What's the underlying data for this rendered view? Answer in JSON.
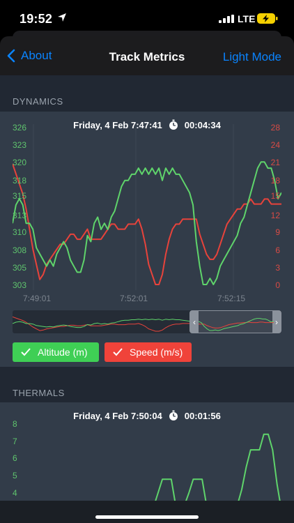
{
  "status_bar": {
    "time": "19:52",
    "network": "LTE"
  },
  "nav": {
    "back_label": "About",
    "title": "Track Metrics",
    "right_label": "Light Mode"
  },
  "dynamics": {
    "section_label": "DYNAMICS",
    "datetime": "Friday, 4 Feb 7:47:41",
    "duration": "00:04:34",
    "legend": {
      "altitude": "Altitude (m)",
      "speed": "Speed (m/s)"
    }
  },
  "thermals": {
    "section_label": "THERMALS",
    "datetime": "Friday, 4 Feb 7:50:04",
    "duration": "00:01:56"
  },
  "colors": {
    "altitude": "#5fd46b",
    "speed": "#e8433b",
    "accent": "#0a84ff"
  },
  "icons": {
    "back": "chevron-left-icon",
    "timer": "stopwatch-icon",
    "check": "checkmark-icon"
  },
  "chart_data": [
    {
      "type": "line",
      "title": "",
      "x_ticks": [
        "7:49:01",
        "7:52:01",
        "7:52:15"
      ],
      "y_left_ticks": [
        "326",
        "323",
        "320",
        "318",
        "315",
        "313",
        "310",
        "308",
        "305",
        "303"
      ],
      "y_right_ticks": [
        "28",
        "24",
        "21",
        "18",
        "15",
        "12",
        "9",
        "6",
        "3",
        "0"
      ],
      "ylim_left": [
        303,
        326
      ],
      "ylim_right": [
        0,
        28
      ],
      "series": [
        {
          "name": "Altitude (m)",
          "axis": "left",
          "values": [
            313,
            316,
            317,
            316,
            313,
            313,
            312,
            309,
            308,
            307,
            306,
            307,
            306,
            308,
            309,
            310,
            309,
            307,
            306,
            305,
            305,
            307,
            311,
            310,
            313,
            314,
            312,
            313,
            312,
            314,
            315,
            317,
            319,
            320,
            320,
            321,
            321,
            322,
            321,
            322,
            321,
            322,
            321,
            322,
            320,
            322,
            321,
            322,
            321,
            321,
            320,
            319,
            318,
            316,
            310,
            306,
            303,
            303,
            304,
            303,
            304,
            306,
            307,
            308,
            309,
            310,
            311,
            313,
            314,
            316,
            318,
            320,
            322,
            323,
            323,
            322,
            322,
            320,
            317,
            318
          ]
        },
        {
          "name": "Speed (m/s)",
          "axis": "right",
          "values": [
            24,
            22,
            20,
            18,
            15,
            11,
            7,
            4,
            1,
            2,
            4,
            5,
            6,
            7,
            8,
            8,
            9,
            10,
            10,
            9,
            9,
            10,
            11,
            9,
            9,
            9,
            9,
            10,
            11,
            12,
            12,
            11,
            11,
            11,
            12,
            12,
            12,
            13,
            11,
            8,
            4,
            2,
            0,
            0,
            2,
            6,
            9,
            11,
            12,
            12,
            13,
            13,
            13,
            13,
            13,
            10,
            8,
            6,
            5,
            5,
            6,
            8,
            10,
            12,
            13,
            14,
            15,
            15,
            16,
            16,
            17,
            16,
            16,
            16,
            17,
            17,
            16,
            16,
            16,
            16
          ]
        }
      ]
    },
    {
      "type": "line",
      "title": "",
      "y_ticks": [
        "8",
        "7",
        "6",
        "5",
        "4"
      ],
      "ylim": [
        3.2,
        8.2
      ],
      "series": [
        {
          "name": "",
          "values": [
            3,
            3,
            3,
            3,
            3,
            3,
            3,
            3,
            3,
            3,
            3,
            3,
            3,
            3,
            3,
            3,
            3,
            3,
            3,
            3,
            3,
            3,
            3,
            3,
            3,
            3,
            3,
            3,
            3,
            3,
            3,
            3,
            3.2,
            4,
            4.8,
            4.8,
            4.8,
            3.3,
            3.3,
            3.3,
            4,
            4.8,
            4.8,
            4.8,
            3.3,
            3.3,
            3.3,
            3.3,
            3.3,
            3.3,
            3.3,
            3.3,
            4.2,
            5.5,
            6.5,
            6.5,
            6.5,
            7.4,
            7.4,
            6.5,
            4.5,
            3
          ]
        }
      ]
    }
  ]
}
